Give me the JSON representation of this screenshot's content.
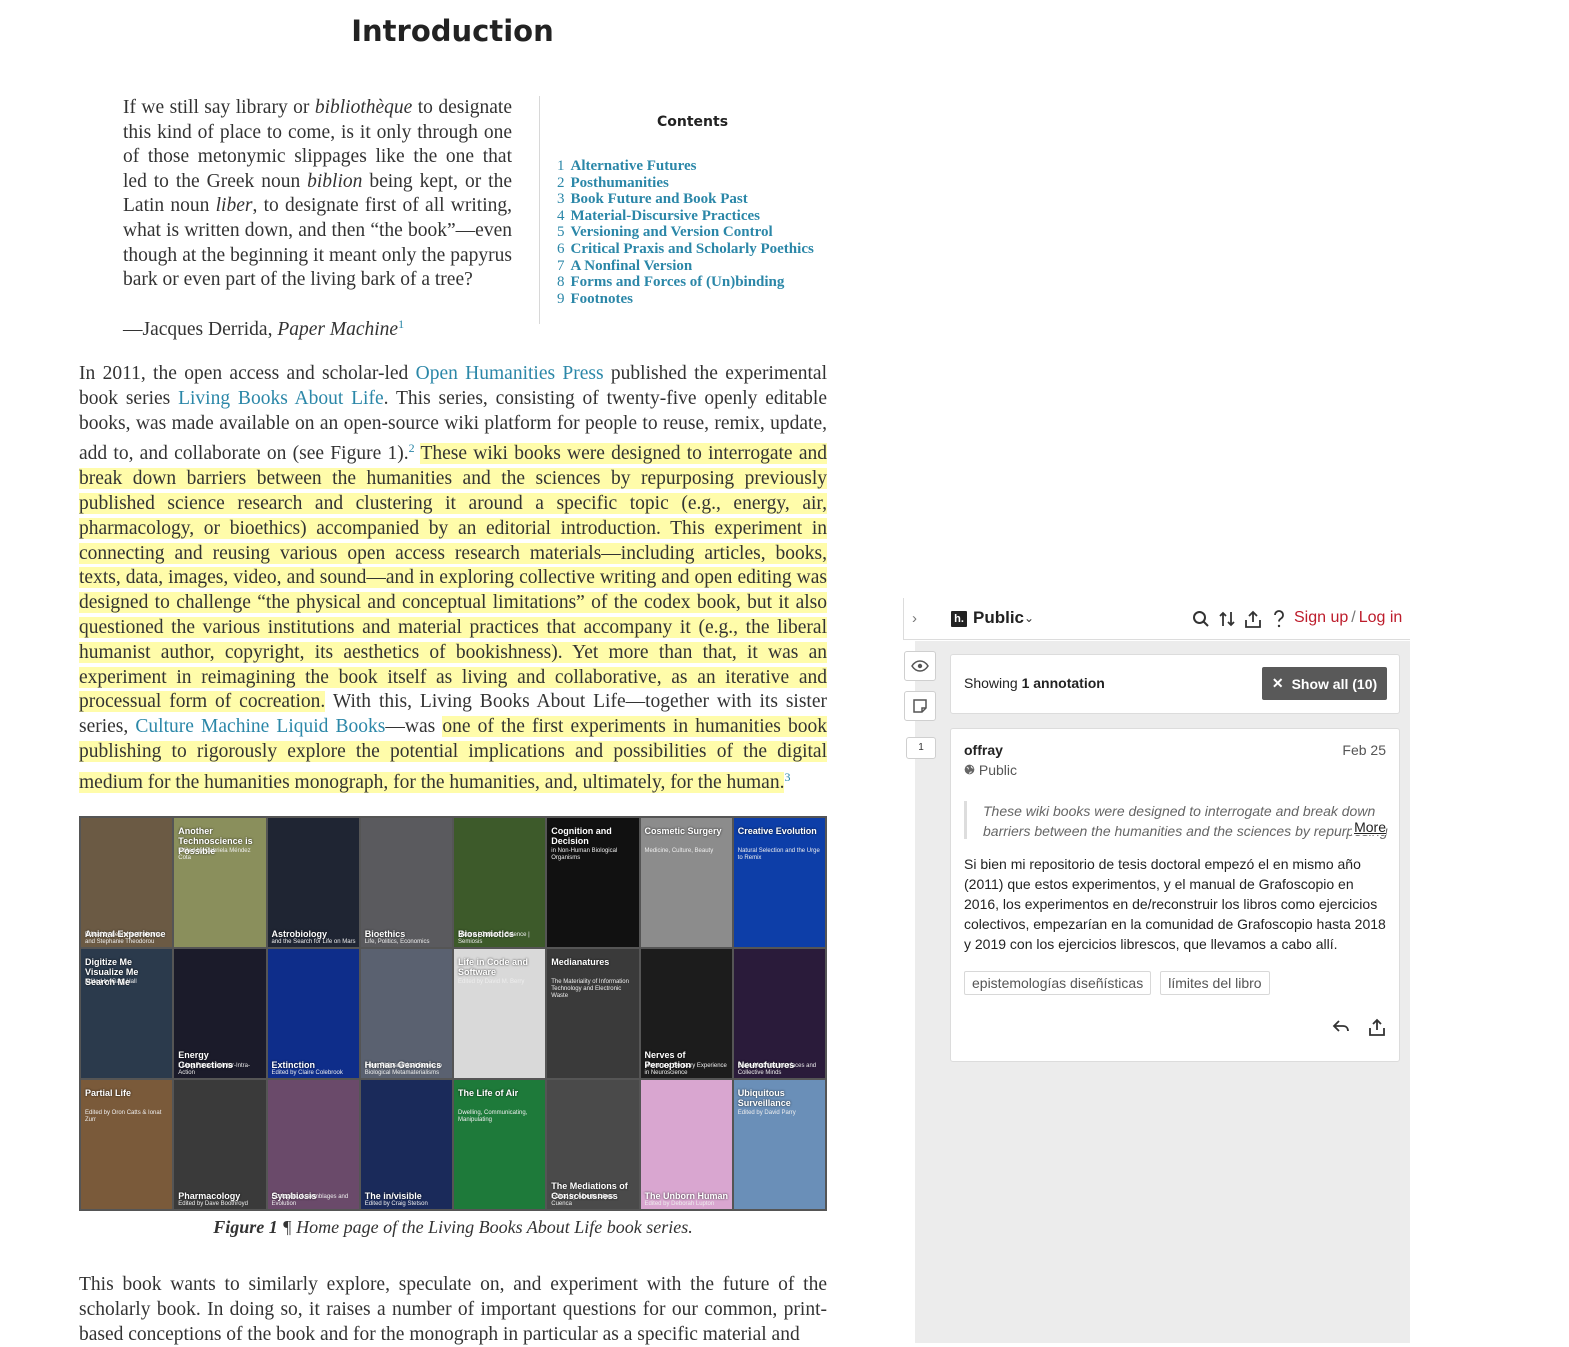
{
  "document": {
    "title": "Introduction",
    "epigraph": {
      "parts": [
        "If we still say library or ",
        "bibliothèque",
        " to designate this kind of place to come, is it only through one of those metonymic slippages like the one that led to the Greek noun ",
        "biblion",
        " being kept, or the Latin noun ",
        "liber",
        ", to designate first of all writing, what is written down, and then “the book”—even though at the beginning it meant only the papyrus bark or even part of the living bark of a tree?"
      ],
      "attribution": "—Jacques Derrida, ",
      "attribution_work": "Paper Machine",
      "footnote": "1"
    },
    "toc": {
      "title": "Contents",
      "items": [
        {
          "num": "1",
          "label": "Alternative Futures"
        },
        {
          "num": "2",
          "label": "Posthumanities"
        },
        {
          "num": "3",
          "label": "Book Future and Book Past"
        },
        {
          "num": "4",
          "label": "Material-Discursive Practices"
        },
        {
          "num": "5",
          "label": "Versioning and Version Control"
        },
        {
          "num": "6",
          "label": "Critical Praxis and Scholarly Poethics"
        },
        {
          "num": "7",
          "label": "A Nonfinal Version"
        },
        {
          "num": "8",
          "label": "Forms and Forces of (Un)binding"
        },
        {
          "num": "9",
          "label": "Footnotes"
        }
      ]
    },
    "paragraph1": {
      "a": "In 2011, the open access and scholar-led ",
      "link1": "Open Humanities Press",
      "b": " published the experimental book series ",
      "link2": "Living Books About Life",
      "c": ". This series, consisting of twenty-five openly editable books, was made available on an open-source wiki platform for people to reuse, remix, update, add to, and collaborate on (see Figure 1).",
      "fn2": "2",
      "d_space": " ",
      "hl1": "These wiki books were designed to interrogate and break down barriers between the humanities and the sciences by repurposing previously published science research and clustering it around a specific topic (e.g., energy, air, pharmacology, or bioethics) accompanied by an editorial introduction. This experiment in connecting and reusing various open access research materials—including articles, books, texts, data, images, video, and sound—and in exploring collective writing and open editing was designed to challenge “the physical and conceptual limitations” of the codex book, but it also questioned the various institutions and material practices that accompany it (e.g., the liberal humanist author, copyright, its aesthetics of bookishness). Yet more than that, it was an experiment in reimagining the book itself as living and collaborative, as an iterative and processual form of cocreation.",
      "e": " With this, Living Books About Life—together with its sister series, ",
      "link3": "Culture Machine Liquid Books",
      "f": "—was ",
      "hl2": "one of the first experiments in humanities book publishing to rigorously explore the potential implications and possibilities of the digital medium for the humanities monograph, for the humanities, and, ultimately, for the human.",
      "fn3": "3"
    },
    "figure": {
      "covers": [
        {
          "title": "Animal Experience",
          "sub": "Edited by Leon Nanthakumar and Stephanie Theodorou",
          "pos": "bot",
          "bg": "#6b5a44"
        },
        {
          "title": "Another Technoscience is Possible",
          "sub": "Edited by Gabriela Méndez Cota",
          "pos": "top",
          "bg": "#8a8f5c"
        },
        {
          "title": "Astrobiology",
          "sub": "and the Search for Life on Mars",
          "pos": "bot",
          "bg": "#1f2533"
        },
        {
          "title": "Bioethics",
          "sub": "Life, Politics, Economics",
          "pos": "bot",
          "bg": "#5a5a5e"
        },
        {
          "title": "Biosemiotics",
          "sub": "Nature | Culture | Science | Semiosis",
          "pos": "bot",
          "bg": "#3d5a2a"
        },
        {
          "title": "Cognition and Decision",
          "sub": "in Non-Human Biological Organisms",
          "pos": "top",
          "bg": "#111111"
        },
        {
          "title": "Cosmetic Surgery",
          "sub": "Medicine, Culture, Beauty",
          "pos": "top",
          "bg": "#8c8c8c"
        },
        {
          "title": "Creative Evolution",
          "sub": "Natural Selection and the Urge to Remix",
          "pos": "top",
          "bg": "#0d3ea8"
        },
        {
          "title": "Digitize Me Visualize Me Search Me",
          "sub": "Edited by Gary Hall",
          "pos": "top",
          "bg": "#2b3a4c"
        },
        {
          "title": "Energy Connections",
          "sub": "Living Forces in Inter-Intra-Action",
          "pos": "bot",
          "bg": "#1b1b2a"
        },
        {
          "title": "Extinction",
          "sub": "Edited by Claire Colebrook",
          "pos": "bot",
          "bg": "#0e2d8a"
        },
        {
          "title": "Human Genomics",
          "sub": "From Philosophical Genes to Biological Metamaterialisms",
          "pos": "bot",
          "bg": "#5a6170"
        },
        {
          "title": "Life in Code and Software",
          "sub": "Edited by David M. Berry",
          "pos": "top",
          "bg": "#d9d9d9"
        },
        {
          "title": "Medianatures",
          "sub": "The Materiality of Information Technology and Electronic Waste",
          "pos": "top",
          "bg": "#3a3a3a"
        },
        {
          "title": "Nerves of Perception",
          "sub": "Motor and Sensory Experience in Neuroscience",
          "pos": "bot",
          "bg": "#1c1c1c"
        },
        {
          "title": "Neurofutures",
          "sub": "Brain-Machine Interfaces and Collective Minds",
          "pos": "bot",
          "bg": "#2a1b3a"
        },
        {
          "title": "Partial Life",
          "sub": "Edited by Oron Catts & Ionat Zurr",
          "pos": "top",
          "bg": "#7a5a3a"
        },
        {
          "title": "Pharmacology",
          "sub": "Edited by Dave Boothroyd",
          "pos": "bot",
          "bg": "#3a3a3a"
        },
        {
          "title": "Symbiosis",
          "sub": "Ecologies, Assemblages and Evolution",
          "pos": "bot",
          "bg": "#6a4a6a"
        },
        {
          "title": "The in/visible",
          "sub": "Edited by Craig Stetson",
          "pos": "bot",
          "bg": "#1a2a5a"
        },
        {
          "title": "The Life of Air",
          "sub": "Dwelling, Communicating, Manipulating",
          "pos": "top",
          "bg": "#1e7a3a"
        },
        {
          "title": "The Mediations of Consciousness",
          "sub": "Edited by Alberto López Cuenca",
          "pos": "bot",
          "bg": "#4a4a4a"
        },
        {
          "title": "The Unborn Human",
          "sub": "Edited by Deborah Lupton",
          "pos": "bot",
          "bg": "#d9a6d0"
        },
        {
          "title": "Ubiquitous Surveillance",
          "sub": "Edited by David Parry",
          "pos": "top",
          "bg": "#6a8fb8"
        }
      ],
      "caption_label": "Figure 1",
      "caption_mark": " ¶ ",
      "caption_text": "Home page of the Living Books About Life book series."
    },
    "paragraph2": "This book wants to similarly explore, speculate on, and experiment with the future of the scholarly book. In doing so, it raises a number of important questions for our common, print-based conceptions of the book and for the monograph in particular as a specific material and"
  },
  "sidebar": {
    "collapse_icon": "chevron-right-icon",
    "logo": "h.",
    "group": "Public",
    "toolbar_icons": [
      "search-icon",
      "sort-icon",
      "share-icon",
      "help-icon"
    ],
    "signup": "Sign up",
    "separator": "/",
    "login": "Log in",
    "rail_count": "1",
    "filter": {
      "prefix": "Showing ",
      "count": "1 annotation",
      "show_all": "Show all (10)"
    },
    "annotation": {
      "user": "offray",
      "date": "Feb 25",
      "visibility": "Public",
      "quote": "These wiki books were designed to interrogate and break down barriers between the humanities and the sciences by repurposing previously published science research",
      "more": "More",
      "text": "Si bien mi repositorio de tesis doctoral empezó el en mismo año (2011) que estos experimentos, y el manual de Grafoscopio en 2016, los experimentos en de/reconstruir los libros como ejercicios colectivos, empezarían en la comunidad de Grafoscopio hasta 2018 y 2019 con los ejercicios librescos, que llevamos a cabo allí.",
      "tags": [
        "epistemologías diseñísticas",
        "límites del libro"
      ]
    },
    "colors": {
      "accent_link": "#2b87a8",
      "highlight": "#fffcaa",
      "auth_red": "#bd1c2b",
      "sidebar_bg": "#ececec"
    }
  }
}
